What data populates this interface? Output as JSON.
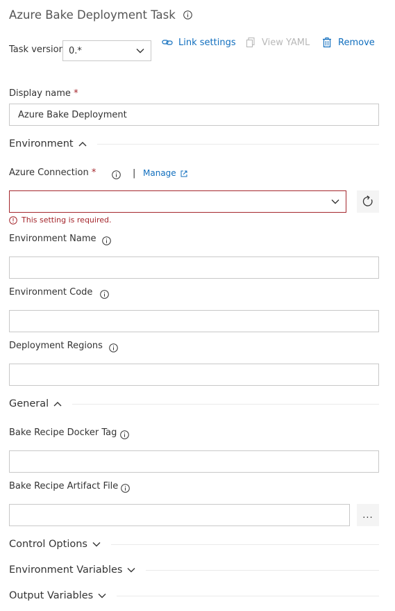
{
  "header": {
    "title": "Azure Bake Deployment Task",
    "title_info_icon": "info-icon"
  },
  "task_version": {
    "label": "Task version",
    "value": "0.*"
  },
  "toolbar": {
    "link_settings": "Link settings",
    "view_yaml": "View YAML",
    "remove": "Remove"
  },
  "display_name": {
    "label": "Display name",
    "required_marker": "*",
    "value": "Azure Bake Deployment"
  },
  "sections": {
    "environment": "Environment",
    "general": "General",
    "control_options": "Control Options",
    "environment_variables": "Environment Variables",
    "output_variables": "Output Variables"
  },
  "azure_connection": {
    "label": "Azure Connection",
    "required_marker": "*",
    "separator": "|",
    "manage": "Manage",
    "value": "",
    "error": "This setting is required."
  },
  "fields": {
    "environment_name": {
      "label": "Environment Name",
      "value": ""
    },
    "environment_code": {
      "label": "Environment Code",
      "value": ""
    },
    "deployment_regions": {
      "label": "Deployment Regions",
      "value": ""
    },
    "bake_recipe_docker_tag": {
      "label": "Bake Recipe Docker Tag",
      "value": ""
    },
    "bake_recipe_artifact_file": {
      "label": "Bake Recipe Artifact File",
      "value": ""
    }
  },
  "buttons": {
    "browse": "..."
  },
  "colors": {
    "accent": "#106ebe",
    "error": "#a4262c",
    "border": "#c8c8c8",
    "disabled": "#b8b8b8"
  }
}
